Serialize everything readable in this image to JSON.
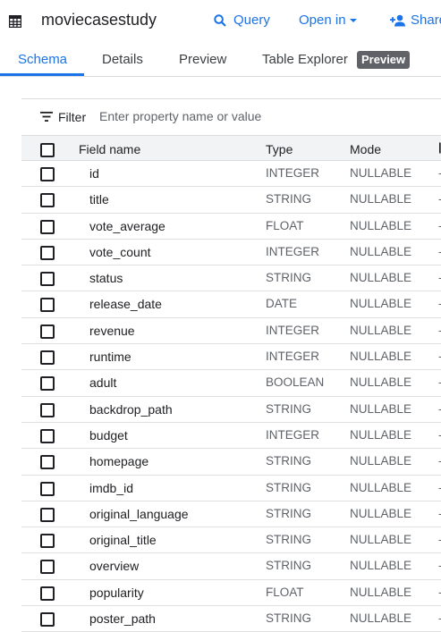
{
  "header": {
    "title": "moviecasestudy",
    "icon": "table-icon",
    "query_label": "Query",
    "open_in_label": "Open in",
    "share_label": "Share",
    "accent_color": "#1a73e8"
  },
  "tabs": [
    {
      "label": "Schema",
      "active": true
    },
    {
      "label": "Details",
      "active": false
    },
    {
      "label": "Preview",
      "active": false
    },
    {
      "label": "Table Explorer",
      "active": false
    }
  ],
  "tab_badge": "Preview",
  "filter": {
    "label": "Filter",
    "placeholder": "Enter property name or value"
  },
  "schema_table": {
    "columns": [
      "Field name",
      "Type",
      "Mode"
    ],
    "rows": [
      {
        "name": "id",
        "type": "INTEGER",
        "mode": "NULLABLE"
      },
      {
        "name": "title",
        "type": "STRING",
        "mode": "NULLABLE"
      },
      {
        "name": "vote_average",
        "type": "FLOAT",
        "mode": "NULLABLE"
      },
      {
        "name": "vote_count",
        "type": "INTEGER",
        "mode": "NULLABLE"
      },
      {
        "name": "status",
        "type": "STRING",
        "mode": "NULLABLE"
      },
      {
        "name": "release_date",
        "type": "DATE",
        "mode": "NULLABLE"
      },
      {
        "name": "revenue",
        "type": "INTEGER",
        "mode": "NULLABLE"
      },
      {
        "name": "runtime",
        "type": "INTEGER",
        "mode": "NULLABLE"
      },
      {
        "name": "adult",
        "type": "BOOLEAN",
        "mode": "NULLABLE"
      },
      {
        "name": "backdrop_path",
        "type": "STRING",
        "mode": "NULLABLE"
      },
      {
        "name": "budget",
        "type": "INTEGER",
        "mode": "NULLABLE"
      },
      {
        "name": "homepage",
        "type": "STRING",
        "mode": "NULLABLE"
      },
      {
        "name": "imdb_id",
        "type": "STRING",
        "mode": "NULLABLE"
      },
      {
        "name": "original_language",
        "type": "STRING",
        "mode": "NULLABLE"
      },
      {
        "name": "original_title",
        "type": "STRING",
        "mode": "NULLABLE"
      },
      {
        "name": "overview",
        "type": "STRING",
        "mode": "NULLABLE"
      },
      {
        "name": "popularity",
        "type": "FLOAT",
        "mode": "NULLABLE"
      },
      {
        "name": "poster_path",
        "type": "STRING",
        "mode": "NULLABLE"
      }
    ]
  }
}
